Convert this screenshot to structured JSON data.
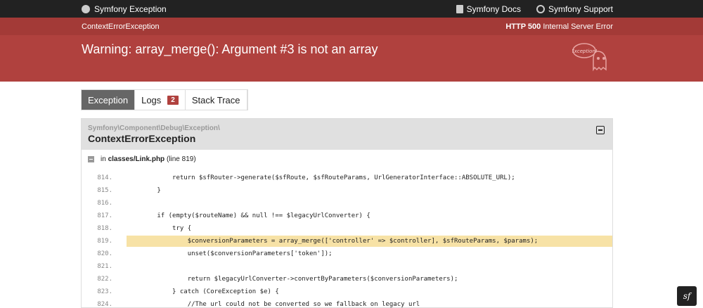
{
  "topbar": {
    "brand": "Symfony Exception",
    "docs": "Symfony Docs",
    "support": "Symfony Support"
  },
  "header": {
    "exception_class": "ContextErrorException",
    "status_code": "HTTP 500",
    "status_text": "Internal Server Error",
    "message": "Warning: array_merge(): Argument #3 is not an array",
    "ghost_label": "Exception!"
  },
  "tabs": {
    "exception": "Exception",
    "logs": "Logs",
    "logs_count": "2",
    "stack_trace": "Stack Trace"
  },
  "trace": {
    "namespace": "Symfony\\Component\\Debug\\Exception\\",
    "class": "ContextErrorException",
    "file_prefix": "in",
    "file": "classes/Link.php",
    "line": "(line 819)"
  },
  "code_lines": [
    {
      "n": "814.",
      "t": "            return $sfRouter->generate($sfRoute, $sfRouteParams, UrlGeneratorInterface::ABSOLUTE_URL);"
    },
    {
      "n": "815.",
      "t": "        }"
    },
    {
      "n": "816.",
      "t": ""
    },
    {
      "n": "817.",
      "t": "        if (empty($routeName) && null !== $legacyUrlConverter) {"
    },
    {
      "n": "818.",
      "t": "            try {"
    },
    {
      "n": "819.",
      "t": "                $conversionParameters = array_merge(['controller' => $controller], $sfRouteParams, $params);",
      "hl": true
    },
    {
      "n": "820.",
      "t": "                unset($conversionParameters['token']);"
    },
    {
      "n": "821.",
      "t": ""
    },
    {
      "n": "822.",
      "t": "                return $legacyUrlConverter->convertByParameters($conversionParameters);"
    },
    {
      "n": "823.",
      "t": "            } catch (CoreException $e) {"
    },
    {
      "n": "824.",
      "t": "                //The url could not be converted so we fallback on legacy url"
    }
  ],
  "corner_logo": "sf"
}
